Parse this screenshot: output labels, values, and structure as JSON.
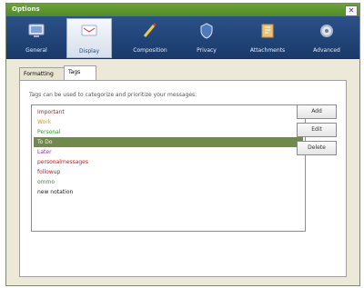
{
  "window": {
    "title": "Options",
    "close_icon": "close-icon"
  },
  "toolbar": {
    "items": [
      {
        "label": "General",
        "icon": "general-icon"
      },
      {
        "label": "Display",
        "icon": "display-icon",
        "selected": true
      },
      {
        "label": "Composition",
        "icon": "pencil-icon"
      },
      {
        "label": "Privacy",
        "icon": "shield-icon"
      },
      {
        "label": "Attachments",
        "icon": "attachment-icon"
      },
      {
        "label": "Advanced",
        "icon": "gear-icon"
      }
    ]
  },
  "tabs": [
    {
      "label": "Formatting",
      "active": false
    },
    {
      "label": "Tags",
      "active": true
    }
  ],
  "tags_panel": {
    "hint": "Tags can be used to categorize and prioritize your messages:",
    "items": [
      {
        "label": "Important",
        "color": "#cc1a1a"
      },
      {
        "label": "Work",
        "color": "#ff8c00"
      },
      {
        "label": "Personal",
        "color": "#22a022"
      },
      {
        "label": "To Do",
        "color": "#ffffff",
        "selected": true
      },
      {
        "label": "Later",
        "color": "#b11ab1"
      },
      {
        "label": "personalmessages",
        "color": "#c21818"
      },
      {
        "label": "followup",
        "color": "#c21818"
      },
      {
        "label": "ommo",
        "color": "#2a9a2a"
      },
      {
        "label": "new notation",
        "color": "#202020"
      }
    ],
    "buttons": {
      "add": "Add",
      "edit": "Edit",
      "delete": "Delete"
    }
  }
}
